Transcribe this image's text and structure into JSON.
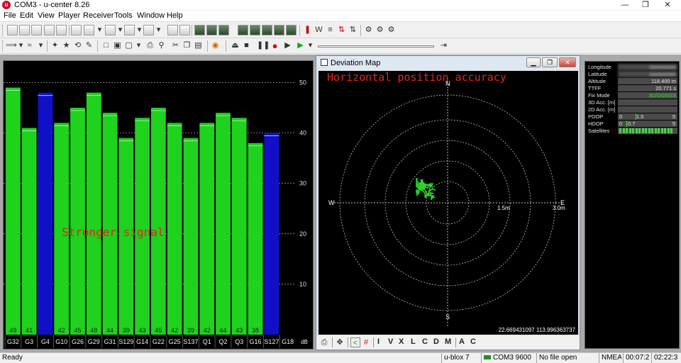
{
  "window": {
    "title": "COM3 - u-center 8.26",
    "icon_letter": "u"
  },
  "menu": [
    "File",
    "Edit",
    "View",
    "Player",
    "Receiver",
    "Tools",
    "Window",
    "Help"
  ],
  "colors": {
    "bar_green": "#1ed21e",
    "bar_blue": "#1010c8",
    "grid": "#c0c0c0",
    "annotation_red": "#e0261c",
    "track_green": "#2bd62b",
    "dash_green": "#3ddc3d"
  },
  "level_panel": {
    "annotation": "Stronger signal",
    "unit": "dB",
    "y_ticks": [
      "50",
      "40",
      "30",
      "20",
      "10"
    ],
    "chart_data": {
      "type": "bar",
      "categories": [
        "G32",
        "G3",
        "G4",
        "G10",
        "G26",
        "G29",
        "G31",
        "S129",
        "G14",
        "G22",
        "G25",
        "S137",
        "Q1",
        "Q2",
        "Q3",
        "G16",
        "S127",
        "G18"
      ],
      "values": [
        49,
        41,
        48,
        42,
        45,
        48,
        44,
        39,
        43,
        45,
        42,
        39,
        42,
        44,
        43,
        38,
        40,
        null
      ],
      "value_labels": [
        "49",
        "41",
        "",
        "42",
        "45",
        "48",
        "44",
        "39",
        "43",
        "45",
        "42",
        "39",
        "42",
        "44",
        "43",
        "38",
        "",
        ""
      ],
      "bar_color": [
        "green",
        "green",
        "blue",
        "green",
        "green",
        "green",
        "green",
        "green",
        "green",
        "green",
        "green",
        "green",
        "green",
        "green",
        "green",
        "green",
        "blue",
        "none"
      ],
      "ylim": [
        0,
        54
      ]
    }
  },
  "deviation_map": {
    "title": "Deviation Map",
    "annotation": "Horizontal position accuracy",
    "compass": {
      "n": "N",
      "s": "S",
      "e": "E",
      "w": "W"
    },
    "ring_labels": [
      "1.5m",
      "3.0m"
    ],
    "coords": "22.669431097 113.996363737",
    "buttons": {
      "minimize": "▁",
      "restore": "❐",
      "close": "✕"
    },
    "tools": [
      "I",
      "V",
      "X",
      "L",
      "C",
      "D",
      "M",
      "A",
      "C"
    ]
  },
  "dashboard": {
    "rows": [
      {
        "label": "Longitude",
        "value": "xxxxxxxxxx"
      },
      {
        "label": "Latitude",
        "value": "xxxxxxxxxx"
      },
      {
        "label": "Altitude",
        "value": "118.400 m"
      },
      {
        "label": "TTFF",
        "value": "20.771 s"
      },
      {
        "label": "Fix Mode",
        "value": "3D/DGNSS"
      },
      {
        "label": "3D Acc. [m]",
        "value": ""
      },
      {
        "label": "2D Acc. [m]",
        "value": ""
      }
    ],
    "pdop": {
      "label": "PDOP",
      "min": "0",
      "value": "1.5",
      "max": "5",
      "level": 1.5
    },
    "hdop": {
      "label": "HDOP",
      "min": "0",
      "value": "0.7",
      "max": "5",
      "level": 0.7
    },
    "satellites": {
      "label": "Satellites",
      "count": 17
    }
  },
  "status_bar": {
    "ready": "Ready",
    "receiver": "u-blox 7",
    "port": "COM3 9600",
    "file": "No file open",
    "protocol": "NMEA",
    "elapsed": "00:07:2",
    "clock": "02:22:3"
  }
}
